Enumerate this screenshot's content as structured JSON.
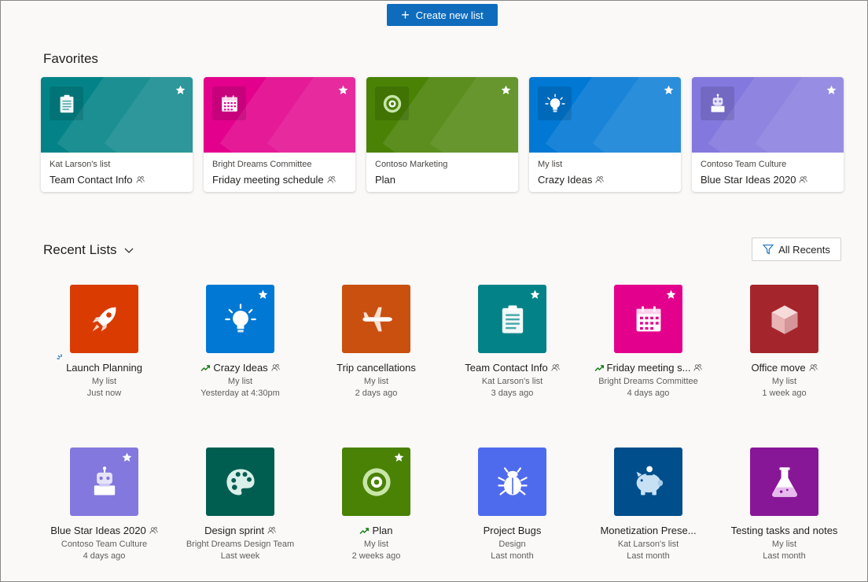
{
  "toolbar": {
    "create_label": "Create new list"
  },
  "colors": {
    "accent": "#0f6cbd"
  },
  "favorites": {
    "title": "Favorites",
    "cards": [
      {
        "sub": "Kat Larson's list",
        "name": "Team Contact Info",
        "color": "#038387",
        "icon": "clipboard-icon",
        "shared": true
      },
      {
        "sub": "Bright Dreams Committee",
        "name": "Friday meeting schedule",
        "color": "#e3008c",
        "icon": "calendar-icon",
        "shared": true
      },
      {
        "sub": "Contoso Marketing",
        "name": "Plan",
        "color": "#498205",
        "icon": "target-icon",
        "shared": false
      },
      {
        "sub": "My list",
        "name": "Crazy Ideas",
        "color": "#0078d4",
        "icon": "lightbulb-icon",
        "shared": true
      },
      {
        "sub": "Contoso Team Culture",
        "name": "Blue Star Ideas 2020",
        "color": "#8378de",
        "icon": "robot-icon",
        "shared": true
      }
    ]
  },
  "recent": {
    "title": "Recent Lists",
    "filter_label": "All Recents",
    "rows": [
      [
        {
          "name": "Launch Planning",
          "sub": "My list",
          "time": "Just now",
          "color": "#da3b01",
          "icon": "rocket-icon",
          "star": false,
          "shared": false,
          "trend": false,
          "spinner": true
        },
        {
          "name": "Crazy Ideas",
          "sub": "My list",
          "time": "Yesterday at 4:30pm",
          "color": "#0078d4",
          "icon": "lightbulb-icon",
          "star": true,
          "shared": true,
          "trend": true
        },
        {
          "name": "Trip cancellations",
          "sub": "My list",
          "time": "2 days ago",
          "color": "#ca5010",
          "icon": "airplane-icon",
          "star": false,
          "shared": false,
          "trend": false
        },
        {
          "name": "Team Contact Info",
          "sub": "Kat Larson's list",
          "time": "3 days ago",
          "color": "#038387",
          "icon": "clipboard-icon",
          "star": true,
          "shared": true,
          "trend": false
        },
        {
          "name": "Friday meeting s...",
          "sub": "Bright Dreams Committee",
          "time": "4 days ago",
          "color": "#e3008c",
          "icon": "calendar-icon",
          "star": true,
          "shared": true,
          "trend": true
        },
        {
          "name": "Office move",
          "sub": "My list",
          "time": "1 week ago",
          "color": "#a4262c",
          "icon": "cube-icon",
          "star": false,
          "shared": true,
          "trend": false
        }
      ],
      [
        {
          "name": "Blue Star Ideas 2020",
          "sub": "Contoso Team Culture",
          "time": "4 days ago",
          "color": "#8378de",
          "icon": "robot-icon",
          "star": true,
          "shared": true,
          "trend": false
        },
        {
          "name": "Design sprint",
          "sub": "Bright Dreams Design Team",
          "time": "Last week",
          "color": "#005e50",
          "icon": "palette-icon",
          "star": false,
          "shared": true,
          "trend": false
        },
        {
          "name": "Plan",
          "sub": "My list",
          "time": "2 weeks ago",
          "color": "#498205",
          "icon": "target-icon",
          "star": true,
          "shared": false,
          "trend": true
        },
        {
          "name": "Project Bugs",
          "sub": "Design",
          "time": "Last month",
          "color": "#4f6bed",
          "icon": "bug-icon",
          "star": false,
          "shared": false,
          "trend": false
        },
        {
          "name": "Monetization Prese...",
          "sub": "Kat Larson's list",
          "time": "Last month",
          "color": "#004e8c",
          "icon": "piggybank-icon",
          "star": false,
          "shared": false,
          "trend": false
        },
        {
          "name": "Testing tasks and notes",
          "sub": "My list",
          "time": "Last month",
          "color": "#881798",
          "icon": "flask-icon",
          "star": false,
          "shared": false,
          "trend": false
        }
      ]
    ]
  }
}
